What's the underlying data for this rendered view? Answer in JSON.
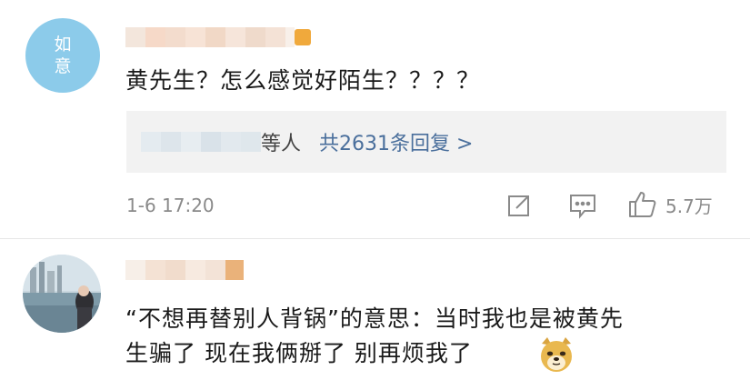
{
  "comments": [
    {
      "avatar_text_top": "如",
      "avatar_text_bottom": "意",
      "text": "黄先生？怎么感觉好陌生？？？？",
      "reply_prefix": "等人",
      "reply_link": "共2631条回复 >",
      "timestamp": "1-6 17:20",
      "like_count": "5.7万"
    },
    {
      "text_line1": "“不想再替别人背锅”的意思：当时我也是被黄先",
      "text_line2": "生骗了 现在我俩掰了 别再烦我了"
    }
  ],
  "icons": [
    "share-icon",
    "comment-icon",
    "like-icon",
    "doge-emoji-icon"
  ]
}
